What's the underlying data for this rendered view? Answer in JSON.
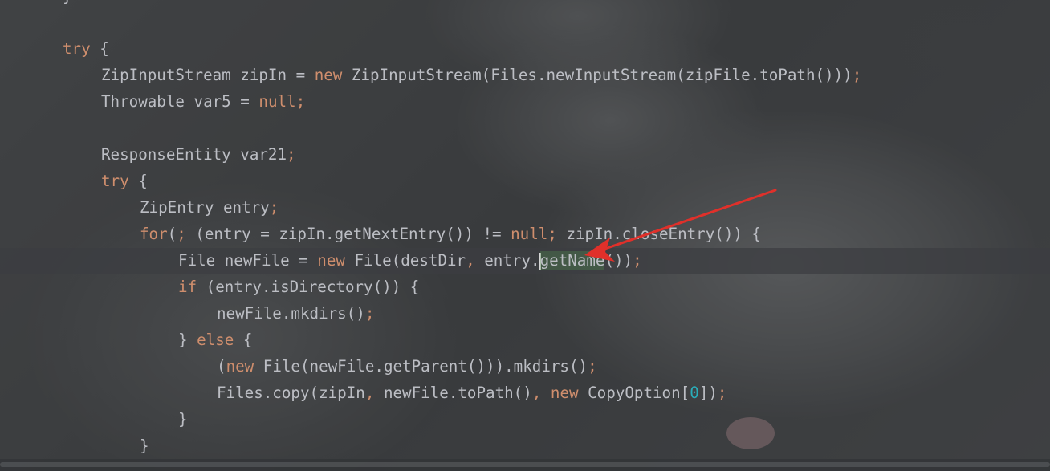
{
  "editor": {
    "lines": [
      {
        "tokens": [
          {
            "t": "}",
            "c": "p"
          }
        ]
      },
      {
        "tokens": []
      },
      {
        "tokens": [
          {
            "t": "try",
            "c": "kw"
          },
          {
            "t": " {",
            "c": "p"
          }
        ]
      },
      {
        "tokens": [
          {
            "t": "ZipInputStream zipIn = ",
            "c": "p"
          },
          {
            "t": "new",
            "c": "kw"
          },
          {
            "t": " ZipInputStream(Files.newInputStream(zipFile.toPath()))",
            "c": "p"
          },
          {
            "t": ";",
            "c": "kw"
          }
        ]
      },
      {
        "tokens": [
          {
            "t": "Throwable var5 = ",
            "c": "p"
          },
          {
            "t": "null",
            "c": "kw"
          },
          {
            "t": ";",
            "c": "kw"
          }
        ]
      },
      {
        "tokens": []
      },
      {
        "tokens": [
          {
            "t": "ResponseEntity var21",
            "c": "p"
          },
          {
            "t": ";",
            "c": "kw"
          }
        ]
      },
      {
        "tokens": [
          {
            "t": "try",
            "c": "kw"
          },
          {
            "t": " {",
            "c": "p"
          }
        ]
      },
      {
        "tokens": [
          {
            "t": "ZipEntry entry",
            "c": "p"
          },
          {
            "t": ";",
            "c": "kw"
          }
        ]
      },
      {
        "tokens": [
          {
            "t": "for",
            "c": "kw"
          },
          {
            "t": "(",
            "c": "p"
          },
          {
            "t": ";",
            "c": "kw"
          },
          {
            "t": " (entry = zipIn.getNextEntry()) != ",
            "c": "p"
          },
          {
            "t": "null",
            "c": "kw"
          },
          {
            "t": ";",
            "c": "kw"
          },
          {
            "t": " zipIn.closeEntry()) {",
            "c": "p"
          }
        ]
      },
      {
        "tokens": [
          {
            "t": "File newFile = ",
            "c": "p"
          },
          {
            "t": "new",
            "c": "kw"
          },
          {
            "t": " File(destDir",
            "c": "p"
          },
          {
            "t": ",",
            "c": "kw"
          },
          {
            "t": " entry.",
            "c": "p"
          },
          {
            "t": "CARET",
            "c": "caret"
          },
          {
            "t": "getName",
            "c": "hl"
          },
          {
            "t": "())",
            "c": "p"
          },
          {
            "t": ";",
            "c": "kw"
          }
        ]
      },
      {
        "tokens": [
          {
            "t": "if",
            "c": "kw"
          },
          {
            "t": " (entry.isDirectory()) {",
            "c": "p"
          }
        ]
      },
      {
        "tokens": [
          {
            "t": "newFile.mkdirs()",
            "c": "p"
          },
          {
            "t": ";",
            "c": "kw"
          }
        ]
      },
      {
        "tokens": [
          {
            "t": "} ",
            "c": "p"
          },
          {
            "t": "else",
            "c": "kw"
          },
          {
            "t": " {",
            "c": "p"
          }
        ]
      },
      {
        "tokens": [
          {
            "t": "(",
            "c": "p"
          },
          {
            "t": "new",
            "c": "kw"
          },
          {
            "t": " File(newFile.getParent())).mkdirs()",
            "c": "p"
          },
          {
            "t": ";",
            "c": "kw"
          }
        ]
      },
      {
        "tokens": [
          {
            "t": "Files.copy(zipIn",
            "c": "p"
          },
          {
            "t": ",",
            "c": "kw"
          },
          {
            "t": " newFile.toPath()",
            "c": "p"
          },
          {
            "t": ",",
            "c": "kw"
          },
          {
            "t": " ",
            "c": "p"
          },
          {
            "t": "new",
            "c": "kw"
          },
          {
            "t": " CopyOption[",
            "c": "p"
          },
          {
            "t": "0",
            "c": "num"
          },
          {
            "t": "])",
            "c": "p"
          },
          {
            "t": ";",
            "c": "kw"
          }
        ]
      },
      {
        "tokens": [
          {
            "t": "}",
            "c": "p"
          }
        ]
      },
      {
        "tokens": [
          {
            "t": "}",
            "c": "p"
          }
        ]
      }
    ]
  },
  "colors": {
    "keyword": "#cf8e6d",
    "text": "#bcbec4",
    "number": "#2aacb8",
    "annotation_arrow": "#e0302a"
  }
}
